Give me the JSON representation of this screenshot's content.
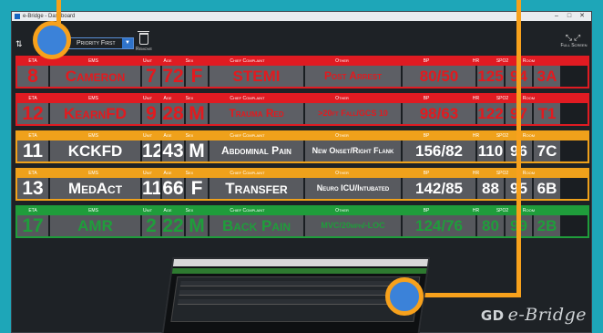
{
  "window": {
    "title": "e-Bridge - Dashboard",
    "controls": [
      "–",
      "□",
      "✕"
    ]
  },
  "toolbar": {
    "sort_icon": "sort-icon",
    "sort_value": "Priority First",
    "remove_label": "Remove",
    "fullscreen_label": "Full Screen"
  },
  "headers": {
    "eta": "ETA",
    "ems": "EMS",
    "unit": "Unit",
    "age": "Age",
    "sex": "Sex",
    "cc": "Chief Complaint",
    "other": "Other",
    "bp": "BP",
    "hr": "HR",
    "spo2": "SPO2",
    "room": "Room"
  },
  "patients": [
    {
      "priority": "red",
      "eta": "8",
      "ems": "Cameron",
      "unit": "7",
      "age": "72",
      "sex": "F",
      "cc": "STEMI",
      "other": "Post Arrest",
      "bp": "80/50",
      "hr": "125",
      "spo2": "94",
      "room": "3A"
    },
    {
      "priority": "red",
      "eta": "12",
      "ems": "KearnFD",
      "unit": "9",
      "age": "28",
      "sex": "M",
      "cc": "Trauma Red",
      "other": ">20ft Fall/GCS 10",
      "bp": "98/63",
      "hr": "122",
      "spo2": "97",
      "room": "T1"
    },
    {
      "priority": "orange",
      "eta": "11",
      "ems": "KCKFD",
      "unit": "12",
      "age": "43",
      "sex": "M",
      "cc": "Abdominal Pain",
      "other": "New Onset/Right Flank",
      "bp": "156/82",
      "hr": "110",
      "spo2": "96",
      "room": "7C"
    },
    {
      "priority": "orange",
      "eta": "13",
      "ems": "MedAct",
      "unit": "11",
      "age": "66",
      "sex": "F",
      "cc": "Transfer",
      "other": "Neuro ICU/Intubated",
      "bp": "142/85",
      "hr": "88",
      "spo2": "95",
      "room": "6B"
    },
    {
      "priority": "green",
      "eta": "17",
      "ems": "AMR",
      "unit": "2",
      "age": "22",
      "sex": "M",
      "cc": "Back Pain",
      "other": "MVC/20mph/-LOC",
      "bp": "124/76",
      "hr": "80",
      "spo2": "99",
      "room": "2B"
    }
  ],
  "brand": {
    "logo": "GD",
    "name": "e-Bridge"
  },
  "colors": {
    "red": "#e01b22",
    "orange": "#efa11b",
    "green": "#1f9d3b",
    "callout": "#f7a11c",
    "circle": "#3b82d9"
  }
}
